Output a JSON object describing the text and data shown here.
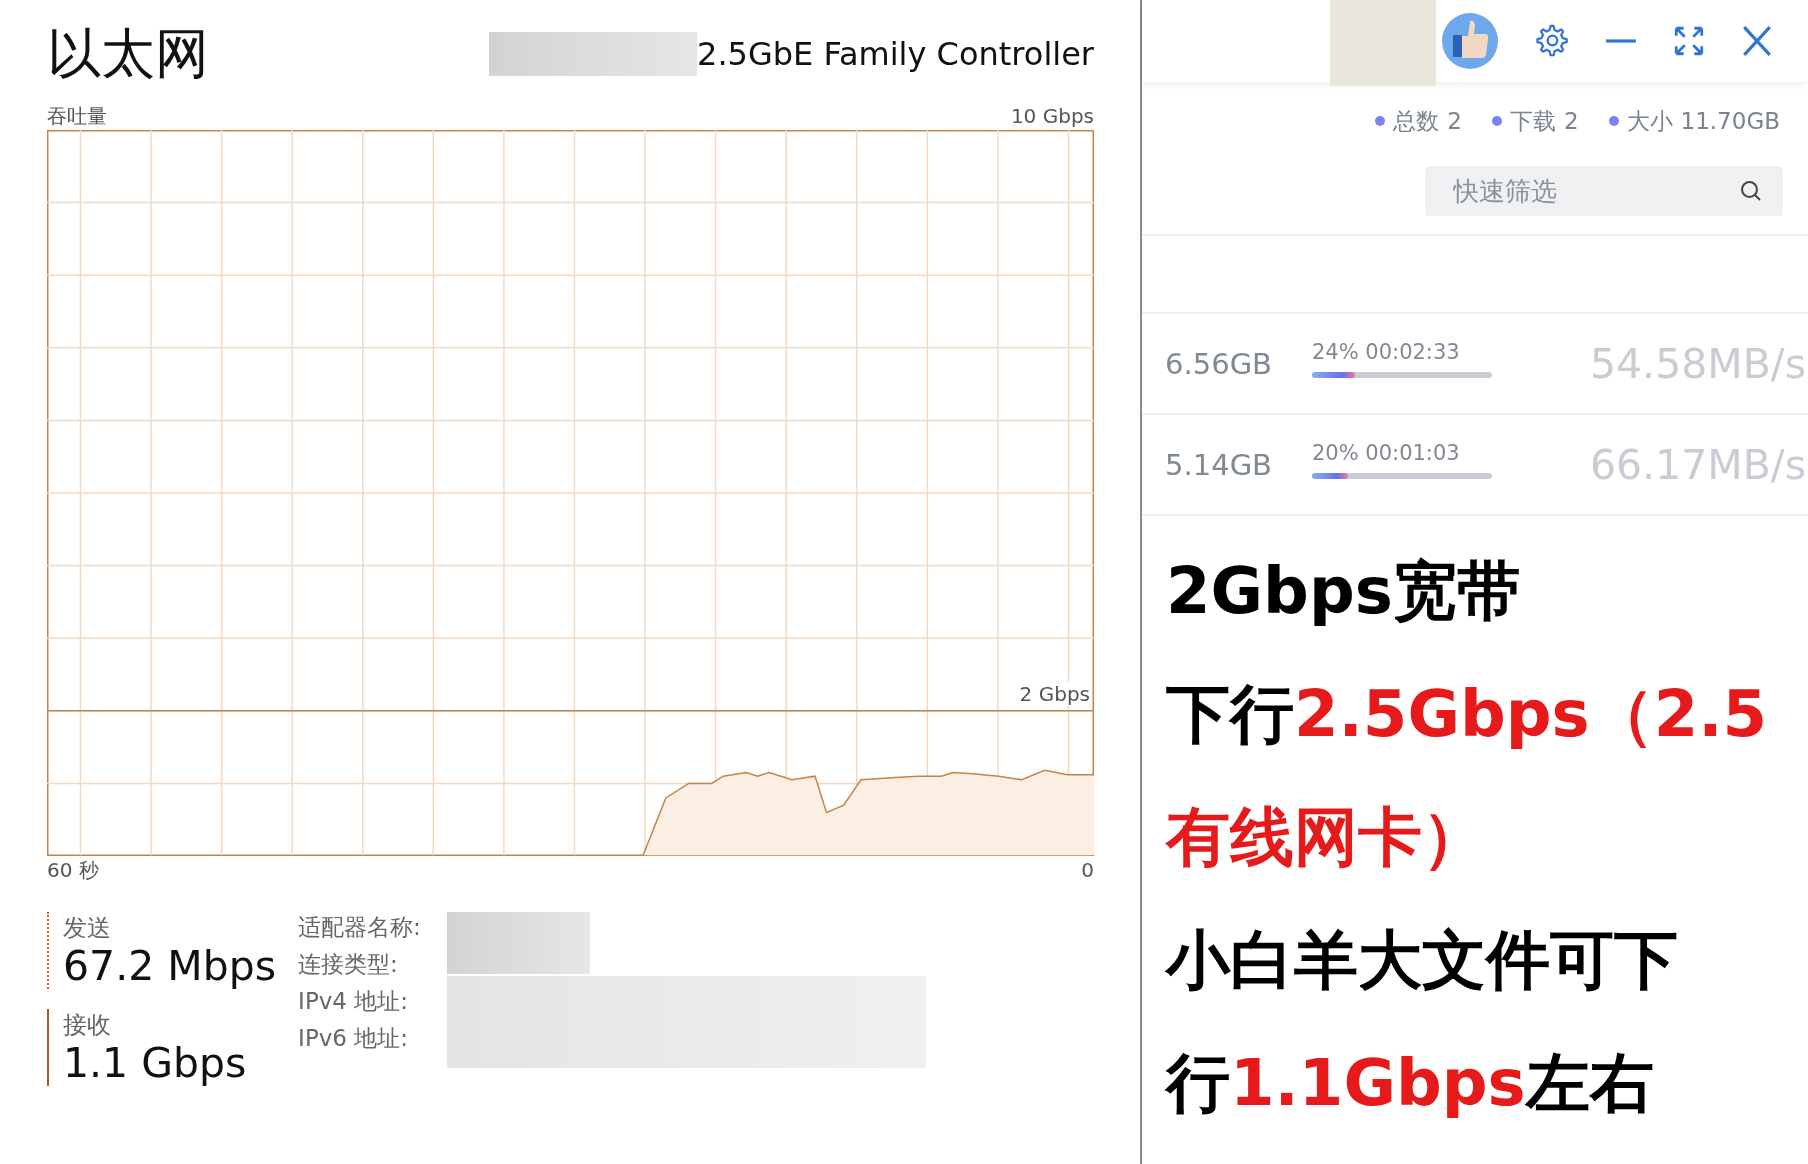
{
  "ethernet": {
    "title": "以太网",
    "adapter": "2.5GbE Family Controller",
    "graph_label": "吞吐量",
    "max_label": "10 Gbps",
    "marker_label": "2 Gbps",
    "time_start": "60 秒",
    "time_end": "0",
    "send": {
      "label": "发送",
      "value": "67.2 Mbps"
    },
    "receive": {
      "label": "接收",
      "value": "1.1 Gbps"
    },
    "details": [
      "适配器名称:",
      "连接类型:",
      "IPv4 地址:",
      "IPv6 地址:"
    ]
  },
  "downloader": {
    "stats": [
      {
        "label": "总数",
        "value": "2",
        "color": "#7b83f0"
      },
      {
        "label": "下载",
        "value": "2",
        "color": "#7b83f0"
      },
      {
        "label": "大小",
        "value": "11.70GB",
        "color": "#7b83f0"
      }
    ],
    "search": {
      "placeholder": "快速筛选"
    },
    "tasks": [
      {
        "size": "6.56GB",
        "progress": "24% 00:02:33",
        "level": 0.24,
        "speed": "54.58MB/s"
      },
      {
        "size": "5.14GB",
        "progress": "20% 00:01:03",
        "level": 0.2,
        "speed": "66.17MB/s"
      }
    ]
  },
  "caption": [
    [
      {
        "text": "2Gbps宽带",
        "highlight": false
      }
    ],
    [
      {
        "text": "下行",
        "highlight": false
      },
      {
        "text": "2.5Gbps（2.5",
        "highlight": true
      }
    ],
    [
      {
        "text": "有线网卡）",
        "highlight": true
      }
    ],
    [
      {
        "text": "小白羊大文件可下",
        "highlight": false
      }
    ],
    [
      {
        "text": "行",
        "highlight": false
      },
      {
        "text": "1.1Gbps",
        "highlight": true
      },
      {
        "text": "左右",
        "highlight": false
      }
    ]
  ]
}
